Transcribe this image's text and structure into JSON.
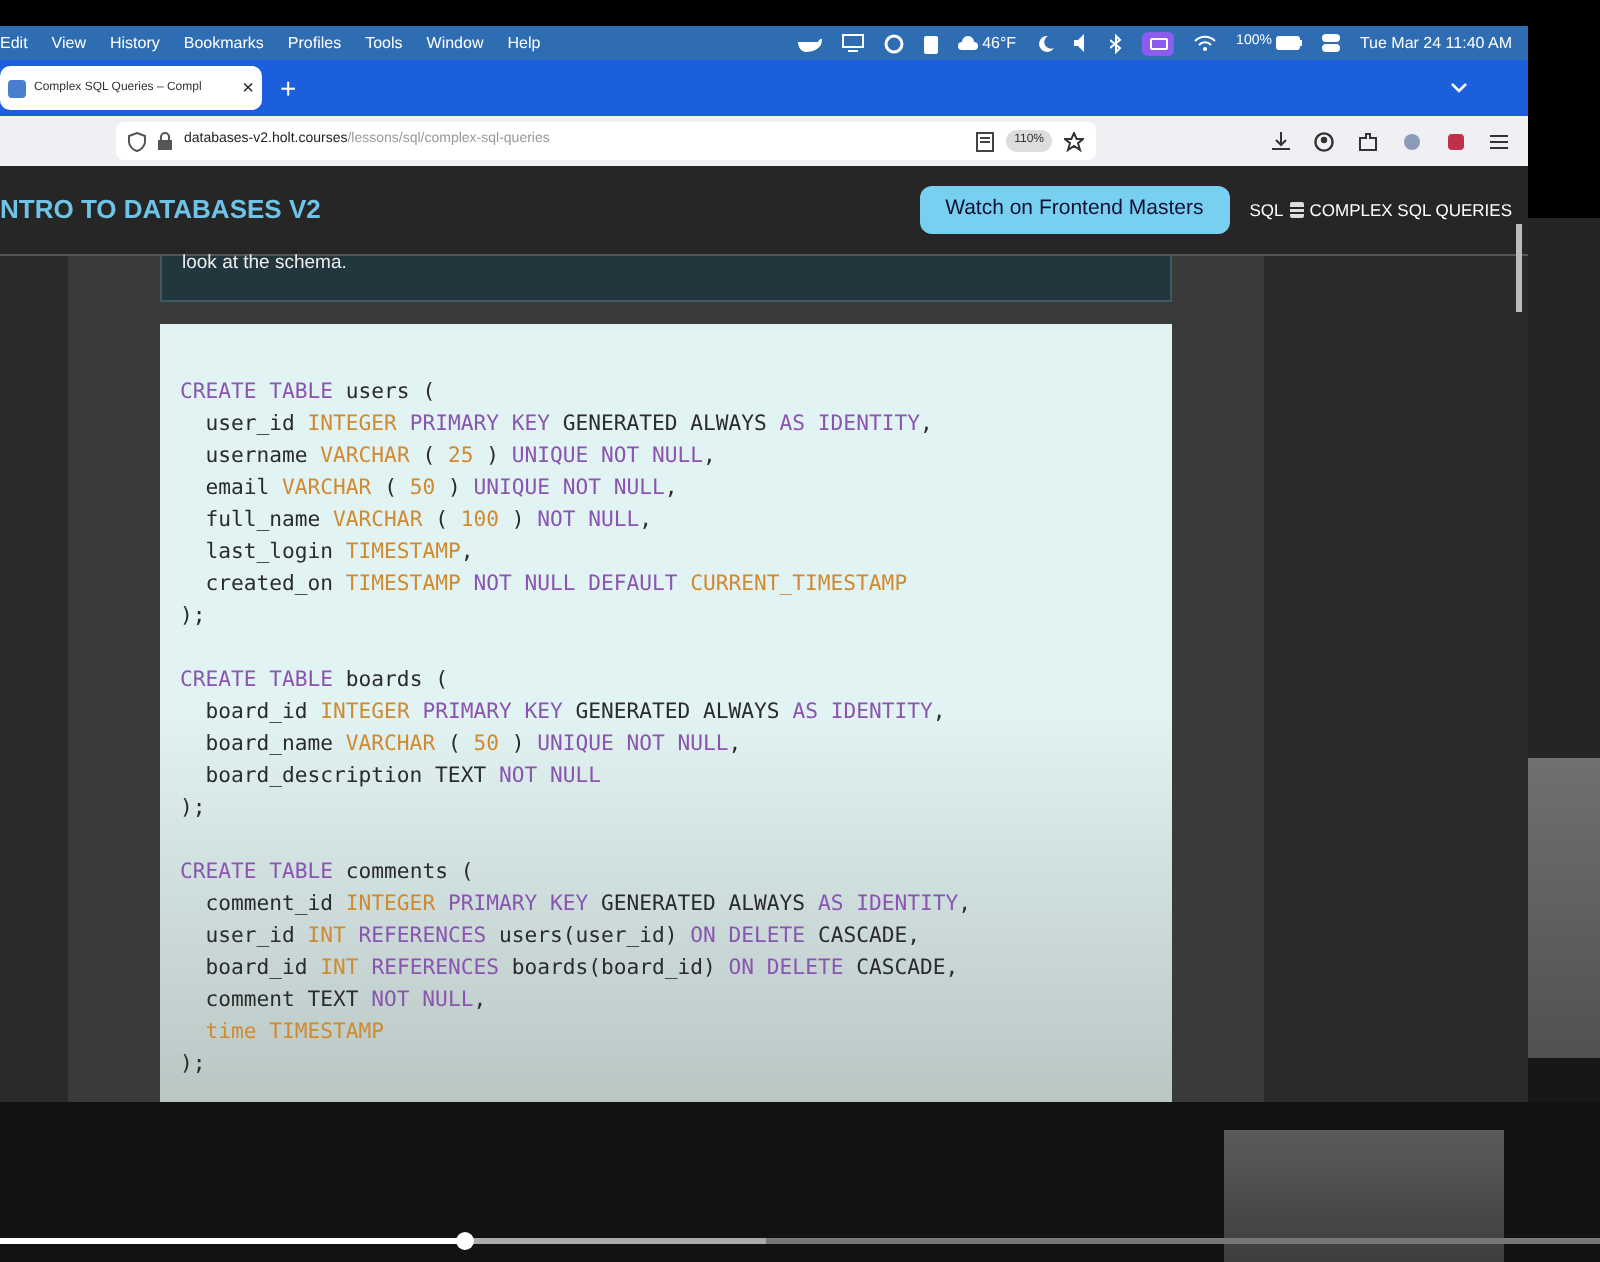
{
  "menu_bar": {
    "items": [
      "Edit",
      "View",
      "History",
      "Bookmarks",
      "Profiles",
      "Tools",
      "Window",
      "Help"
    ],
    "temperature": "46°F",
    "battery": "100%",
    "clock": "Tue Mar 24 11:40 AM"
  },
  "browser": {
    "tab": {
      "title": "Complex SQL Queries – Compl",
      "close": "×",
      "selected": true
    },
    "new_tab": "+",
    "url": {
      "domain": "databases-v2.holt.courses",
      "path": "/lessons/sql/complex-sql-queries"
    },
    "zoom": "110%"
  },
  "header": {
    "title": "NTRO TO DATABASES V2",
    "watch_button": "Watch on Frontend Masters",
    "breadcrumb": {
      "section": "SQL",
      "page": "COMPLEX SQL QUERIES"
    }
  },
  "note": "look at the schema.",
  "code": [
    [
      [
        {
          "text": "CREATE TABLE",
          "kind": "keyword"
        },
        {
          "text": " users (",
          "kind": "plain"
        }
      ],
      [
        {
          "text": "  user_id ",
          "kind": "plain"
        },
        {
          "text": "INTEGER",
          "kind": "type"
        },
        {
          "text": " PRIMARY KEY",
          "kind": "keyword"
        },
        {
          "text": " GENERATED ALWAYS ",
          "kind": "plain"
        },
        {
          "text": "AS IDENTITY",
          "kind": "keyword"
        },
        {
          "text": ",",
          "kind": "plain"
        }
      ],
      [
        {
          "text": "  username ",
          "kind": "plain"
        },
        {
          "text": "VARCHAR",
          "kind": "type"
        },
        {
          "text": " ( ",
          "kind": "plain"
        },
        {
          "text": "25",
          "kind": "type"
        },
        {
          "text": " ) ",
          "kind": "plain"
        },
        {
          "text": "UNIQUE NOT NULL",
          "kind": "keyword"
        },
        {
          "text": ",",
          "kind": "plain"
        }
      ],
      [
        {
          "text": "  email ",
          "kind": "plain"
        },
        {
          "text": "VARCHAR",
          "kind": "type"
        },
        {
          "text": " ( ",
          "kind": "plain"
        },
        {
          "text": "50",
          "kind": "type"
        },
        {
          "text": " ) ",
          "kind": "plain"
        },
        {
          "text": "UNIQUE NOT NULL",
          "kind": "keyword"
        },
        {
          "text": ",",
          "kind": "plain"
        }
      ],
      [
        {
          "text": "  full_name ",
          "kind": "plain"
        },
        {
          "text": "VARCHAR",
          "kind": "type"
        },
        {
          "text": " ( ",
          "kind": "plain"
        },
        {
          "text": "100",
          "kind": "type"
        },
        {
          "text": " ) ",
          "kind": "plain"
        },
        {
          "text": "NOT NULL",
          "kind": "keyword"
        },
        {
          "text": ",",
          "kind": "plain"
        }
      ],
      [
        {
          "text": "  last_login ",
          "kind": "plain"
        },
        {
          "text": "TIMESTAMP",
          "kind": "type"
        },
        {
          "text": ",",
          "kind": "plain"
        }
      ],
      [
        {
          "text": "  created_on ",
          "kind": "plain"
        },
        {
          "text": "TIMESTAMP",
          "kind": "type"
        },
        {
          "text": " NOT NULL DEFAULT ",
          "kind": "keyword"
        },
        {
          "text": "CURRENT_TIMESTAMP",
          "kind": "type"
        }
      ],
      [
        {
          "text": ");",
          "kind": "plain"
        }
      ]
    ],
    [
      [
        {
          "text": "CREATE TABLE",
          "kind": "keyword"
        },
        {
          "text": " boards (",
          "kind": "plain"
        }
      ],
      [
        {
          "text": "  board_id ",
          "kind": "plain"
        },
        {
          "text": "INTEGER",
          "kind": "type"
        },
        {
          "text": " PRIMARY KEY",
          "kind": "keyword"
        },
        {
          "text": " GENERATED ALWAYS ",
          "kind": "plain"
        },
        {
          "text": "AS IDENTITY",
          "kind": "keyword"
        },
        {
          "text": ",",
          "kind": "plain"
        }
      ],
      [
        {
          "text": "  board_name ",
          "kind": "plain"
        },
        {
          "text": "VARCHAR",
          "kind": "type"
        },
        {
          "text": " ( ",
          "kind": "plain"
        },
        {
          "text": "50",
          "kind": "type"
        },
        {
          "text": " ) ",
          "kind": "plain"
        },
        {
          "text": "UNIQUE NOT NULL",
          "kind": "keyword"
        },
        {
          "text": ",",
          "kind": "plain"
        }
      ],
      [
        {
          "text": "  board_description TEXT ",
          "kind": "plain"
        },
        {
          "text": "NOT NULL",
          "kind": "keyword"
        }
      ],
      [
        {
          "text": ");",
          "kind": "plain"
        }
      ]
    ],
    [
      [
        {
          "text": "CREATE TABLE",
          "kind": "keyword"
        },
        {
          "text": " comments (",
          "kind": "plain"
        }
      ],
      [
        {
          "text": "  comment_id ",
          "kind": "plain"
        },
        {
          "text": "INTEGER",
          "kind": "type"
        },
        {
          "text": " PRIMARY KEY",
          "kind": "keyword"
        },
        {
          "text": " GENERATED ALWAYS ",
          "kind": "plain"
        },
        {
          "text": "AS IDENTITY",
          "kind": "keyword"
        },
        {
          "text": ",",
          "kind": "plain"
        }
      ],
      [
        {
          "text": "  user_id ",
          "kind": "plain"
        },
        {
          "text": "INT",
          "kind": "type"
        },
        {
          "text": " REFERENCES",
          "kind": "keyword"
        },
        {
          "text": " users(user_id) ",
          "kind": "plain"
        },
        {
          "text": "ON DELETE",
          "kind": "keyword"
        },
        {
          "text": " CASCADE,",
          "kind": "plain"
        }
      ],
      [
        {
          "text": "  board_id ",
          "kind": "plain"
        },
        {
          "text": "INT",
          "kind": "type"
        },
        {
          "text": " REFERENCES",
          "kind": "keyword"
        },
        {
          "text": " boards(board_id) ",
          "kind": "plain"
        },
        {
          "text": "ON DELETE",
          "kind": "keyword"
        },
        {
          "text": " CASCADE,",
          "kind": "plain"
        }
      ],
      [
        {
          "text": "  comment TEXT ",
          "kind": "plain"
        },
        {
          "text": "NOT NULL",
          "kind": "keyword"
        },
        {
          "text": ",",
          "kind": "plain"
        }
      ],
      [
        {
          "text": "  time TIMESTAMP",
          "kind": "type"
        }
      ],
      [
        {
          "text": ");",
          "kind": "plain"
        }
      ]
    ]
  ],
  "video_progress": {
    "level": 0.29
  }
}
